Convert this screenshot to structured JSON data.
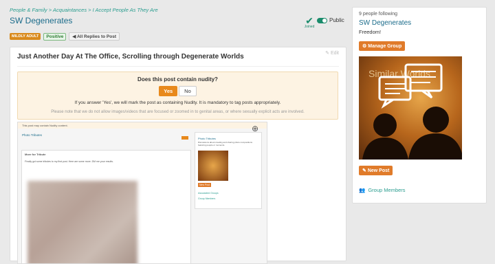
{
  "breadcrumb": "People & Family > Acquaintances > I Accept People As They Are",
  "group": {
    "title": "SW Degenerates",
    "joined_label": "Joined",
    "visibility": "Public"
  },
  "badges": {
    "adult": "MILDLY ADULT",
    "positive": "Positive",
    "replies": "All Replies to Post"
  },
  "post": {
    "title": "Just Another Day At The Office, Scrolling through Degenerate Worlds",
    "edit": "Edit",
    "nudity": {
      "question": "Does this post contain nudity?",
      "yes": "Yes",
      "no": "No",
      "info": "If you answer 'Yes', we will mark the post as containing Nudity. It is mandatory to tag posts appropriately.",
      "note": "Please note that we do not allow images/videos that are focused or zoomed in to genital areas, or where sexually explicit acts are involved."
    },
    "screenshot": {
      "warning": "This post may contain Nudity content.",
      "group_name": "Photo Tributes",
      "post_title": "More for Tribute",
      "post_text": "Finally got some tributes to my first post. Here are some more. DM me your results.",
      "side_title": "Photo Tributes",
      "side_text": "Discussions about creating and sharing photo compositions featuring people or moments.",
      "side_btn": "New Post",
      "link1": "Associated Groups",
      "link2": "Group Members"
    }
  },
  "sidebar": {
    "following": "9 people following",
    "group_name": "SW Degenerates",
    "tagline": "Freedom!",
    "manage_btn": "Manage Group",
    "image_text": "Similar Worlds",
    "new_post_btn": "New Post",
    "members_link": "Group Members"
  },
  "colors": {
    "accent_orange": "#e07b2a",
    "teal": "#2a9d8f",
    "title_blue": "#1a6b8a"
  }
}
